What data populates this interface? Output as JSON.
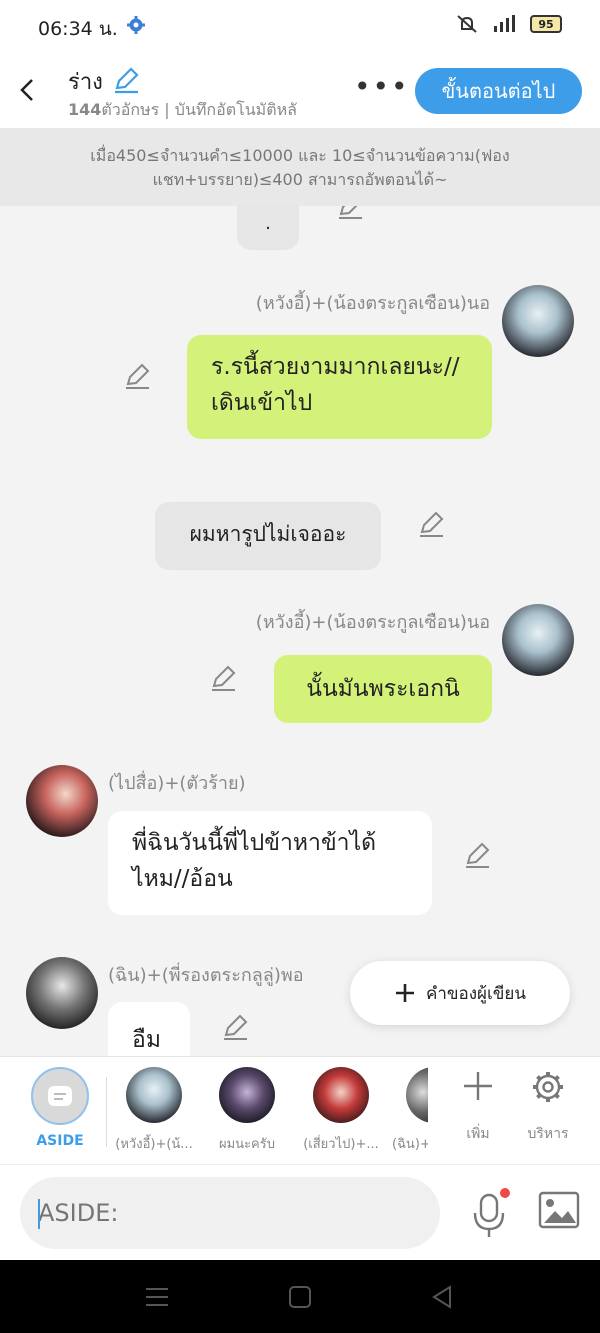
{
  "status": {
    "time": "06:34 น.",
    "battery": "95"
  },
  "header": {
    "title": "ร่าง",
    "char_count": "144",
    "subtitle_rest": "ตัวอักษร | บันทึกอัตโนมัติหลั",
    "next_label": "ขั้นตอนต่อไป"
  },
  "notice": "เมื่อ450≤จำนวนคำ≤10000 และ 10≤จำนวนข้อความ(ฟองแชท+บรรยาย)≤400 สามารถอัพตอนได้~",
  "messages": [
    {
      "text": "."
    },
    {
      "speaker": "(หวังอี้)+(น้องตระกูลเซือน)นอ",
      "text": "ร.รนี้สวยงามมากเลยนะ//เดินเข้าไป"
    },
    {
      "text": "ผมหารูปไม่เจออะ"
    },
    {
      "speaker": "(หวังอี้)+(น้องตระกูลเซือน)นอ",
      "text": "นั้นมันพระเอกนิ"
    },
    {
      "speaker": "(ไปสื่อ)+(ตัวร้าย)",
      "text": "พี่ฉินวันนี้พี่ไปข้าหาข้าได้ไหม//อ้อน"
    },
    {
      "speaker": "(ฉิน)+(พี่รองตระกลูลู่)พอ",
      "text": "อืม"
    }
  ],
  "author_note": "คำของผู้เขียน",
  "characters": [
    {
      "label": "ASIDE"
    },
    {
      "label": "(หวังอี้)+(น้..."
    },
    {
      "label": "ผมนะครับ"
    },
    {
      "label": "(เสี่ยวไป)+..."
    },
    {
      "label": "(ฉิน)+"
    }
  ],
  "tools": {
    "add": "เพิ่ม",
    "manage": "บริหาร"
  },
  "input": {
    "placeholder": "ASIDE:"
  },
  "colors": {
    "accent": "#3d9de8",
    "green_bubble": "#d4f27a",
    "gray_bubble": "#e6e6e6"
  }
}
